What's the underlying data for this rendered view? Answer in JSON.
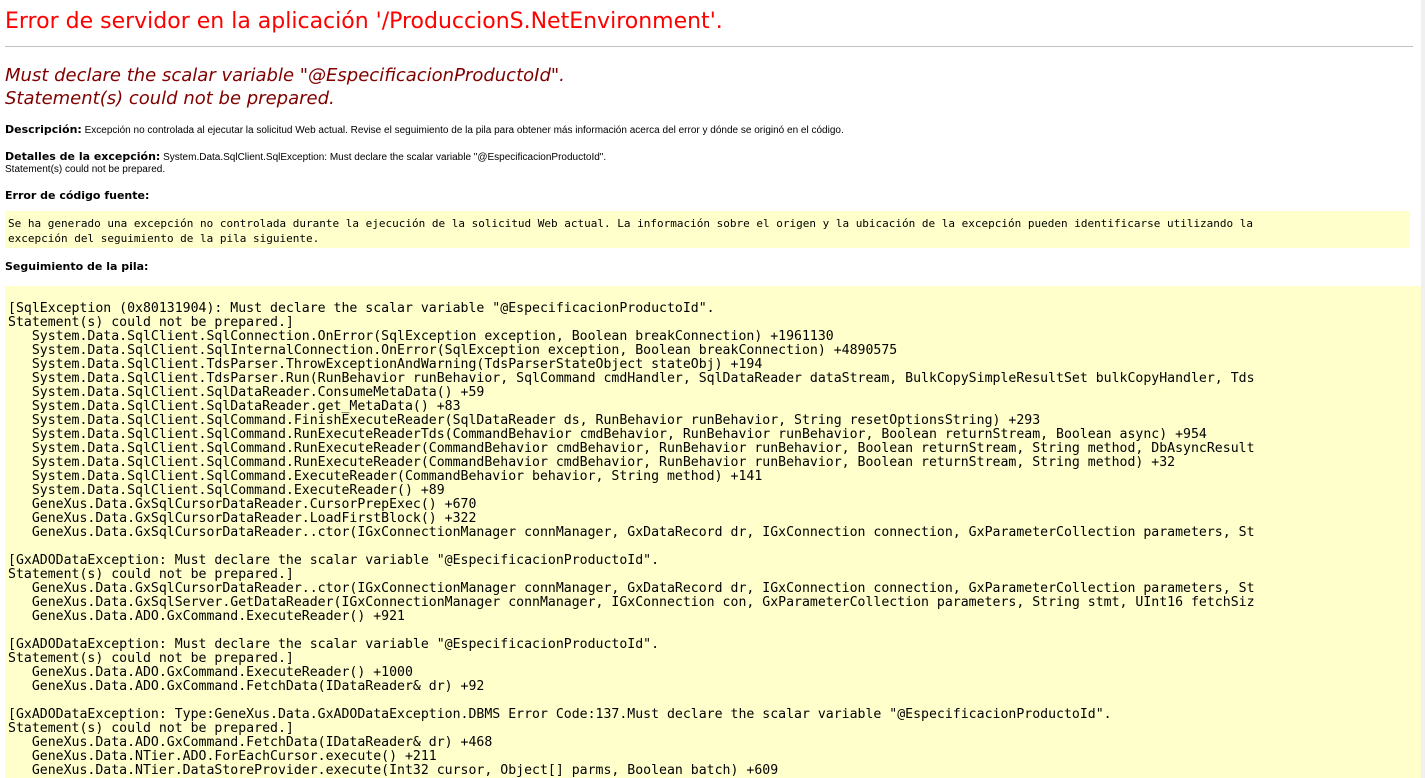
{
  "page": {
    "title": "Error de servidor en la aplicación '/ProduccionS.NetEnvironment'.",
    "subtitle_lines": [
      "Must declare the scalar variable \"@EspecificacionProductoId\".",
      "Statement(s) could not be prepared."
    ]
  },
  "description": {
    "label": "Descripción:",
    "text": " Excepción no controlada al ejecutar la solicitud Web actual. Revise el seguimiento de la pila para obtener más información acerca del error y dónde se originó en el código."
  },
  "exception_details": {
    "label": "Detalles de la excepción:",
    "lines": [
      " System.Data.SqlClient.SqlException: Must declare the scalar variable \"@EspecificacionProductoId\".",
      "Statement(s) could not be prepared."
    ]
  },
  "source_error": {
    "label": "Error de código fuente:",
    "text": "Se ha generado una excepción no controlada durante la ejecución de la solicitud Web actual. La información sobre el origen y la ubicación de la excepción pueden identificarse utilizando la\nexcepción del seguimiento de la pila siguiente."
  },
  "stack_trace": {
    "label": "Seguimiento de la pila:",
    "lines": [
      "[SqlException (0x80131904): Must declare the scalar variable \"@EspecificacionProductoId\".",
      "Statement(s) could not be prepared.]",
      "   System.Data.SqlClient.SqlConnection.OnError(SqlException exception, Boolean breakConnection) +1961130",
      "   System.Data.SqlClient.SqlInternalConnection.OnError(SqlException exception, Boolean breakConnection) +4890575",
      "   System.Data.SqlClient.TdsParser.ThrowExceptionAndWarning(TdsParserStateObject stateObj) +194",
      "   System.Data.SqlClient.TdsParser.Run(RunBehavior runBehavior, SqlCommand cmdHandler, SqlDataReader dataStream, BulkCopySimpleResultSet bulkCopyHandler, Tds",
      "   System.Data.SqlClient.SqlDataReader.ConsumeMetaData() +59",
      "   System.Data.SqlClient.SqlDataReader.get_MetaData() +83",
      "   System.Data.SqlClient.SqlCommand.FinishExecuteReader(SqlDataReader ds, RunBehavior runBehavior, String resetOptionsString) +293",
      "   System.Data.SqlClient.SqlCommand.RunExecuteReaderTds(CommandBehavior cmdBehavior, RunBehavior runBehavior, Boolean returnStream, Boolean async) +954",
      "   System.Data.SqlClient.SqlCommand.RunExecuteReader(CommandBehavior cmdBehavior, RunBehavior runBehavior, Boolean returnStream, String method, DbAsyncResult",
      "   System.Data.SqlClient.SqlCommand.RunExecuteReader(CommandBehavior cmdBehavior, RunBehavior runBehavior, Boolean returnStream, String method) +32",
      "   System.Data.SqlClient.SqlCommand.ExecuteReader(CommandBehavior behavior, String method) +141",
      "   System.Data.SqlClient.SqlCommand.ExecuteReader() +89",
      "   GeneXus.Data.GxSqlCursorDataReader.CursorPrepExec() +670",
      "   GeneXus.Data.GxSqlCursorDataReader.LoadFirstBlock() +322",
      "   GeneXus.Data.GxSqlCursorDataReader..ctor(IGxConnectionManager connManager, GxDataRecord dr, IGxConnection connection, GxParameterCollection parameters, St",
      "",
      "[GxADODataException: Must declare the scalar variable \"@EspecificacionProductoId\".",
      "Statement(s) could not be prepared.]",
      "   GeneXus.Data.GxSqlCursorDataReader..ctor(IGxConnectionManager connManager, GxDataRecord dr, IGxConnection connection, GxParameterCollection parameters, St",
      "   GeneXus.Data.GxSqlServer.GetDataReader(IGxConnectionManager connManager, IGxConnection con, GxParameterCollection parameters, String stmt, UInt16 fetchSiz",
      "   GeneXus.Data.ADO.GxCommand.ExecuteReader() +921",
      "",
      "[GxADODataException: Must declare the scalar variable \"@EspecificacionProductoId\".",
      "Statement(s) could not be prepared.]",
      "   GeneXus.Data.ADO.GxCommand.ExecuteReader() +1000",
      "   GeneXus.Data.ADO.GxCommand.FetchData(IDataReader& dr) +92",
      "",
      "[GxADODataException: Type:GeneXus.Data.GxADODataException.DBMS Error Code:137.Must declare the scalar variable \"@EspecificacionProductoId\".",
      "Statement(s) could not be prepared.]",
      "   GeneXus.Data.ADO.GxCommand.FetchData(IDataReader& dr) +468",
      "   GeneXus.Data.NTier.ADO.ForEachCursor.execute() +211",
      "   GeneXus.Data.NTier.DataStoreProvider.execute(Int32 cursor, Object[] parms, Boolean batch) +609"
    ]
  }
}
